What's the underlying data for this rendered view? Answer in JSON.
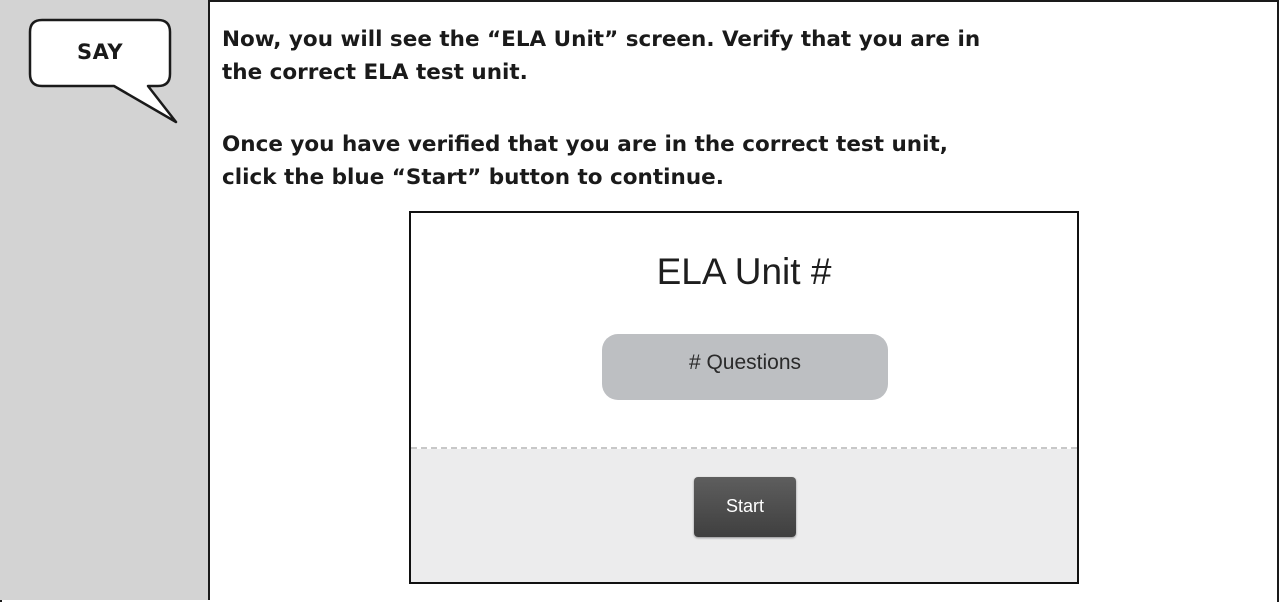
{
  "say_label": "SAY",
  "paragraphs": {
    "first": "Now, you will see the “ELA Unit” screen. Verify that you are in the correct ELA test unit.",
    "second": "Once you have verified that you are in the correct test unit, click the blue “Start” button to continue."
  },
  "screen": {
    "title": "ELA Unit #",
    "questions_label": "# Questions",
    "start_label": "Start"
  },
  "colors": {
    "left_column": "#d3d3d3",
    "pill": "#bdbfc2",
    "button": "#4a4a4a",
    "bottom_panel": "#ececed"
  },
  "icons": {
    "say_bubble": "speech-bubble-icon"
  }
}
